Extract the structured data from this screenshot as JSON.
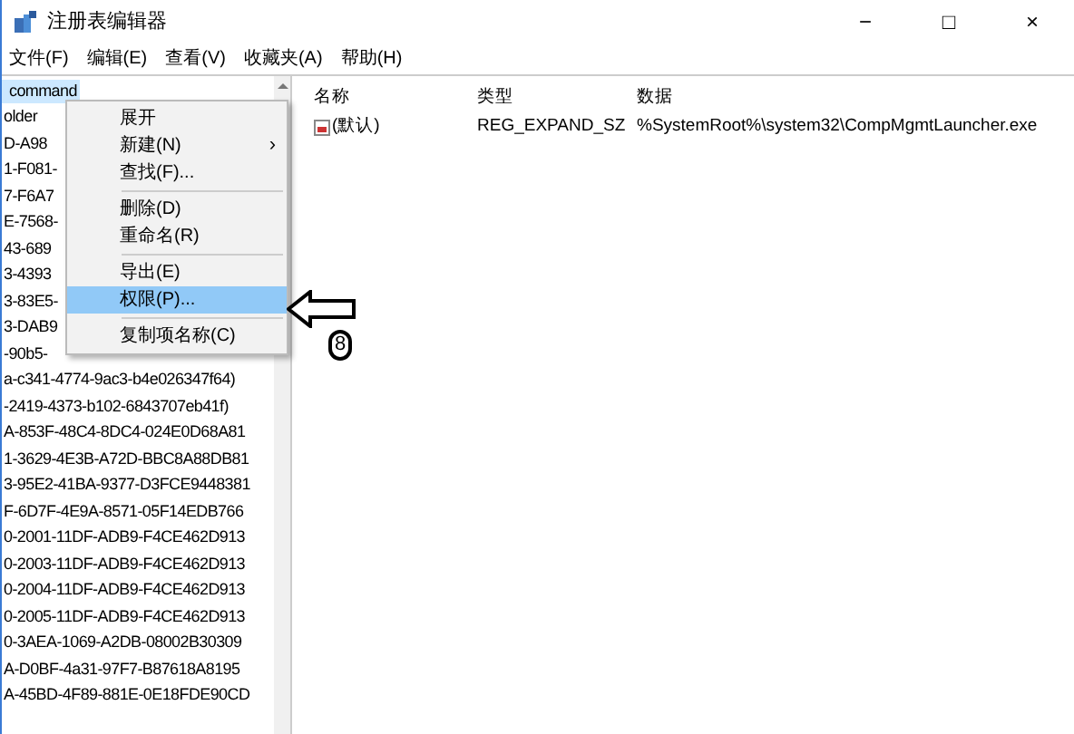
{
  "window": {
    "title": "注册表编辑器",
    "controls": [
      "−",
      "□",
      "×"
    ]
  },
  "menu_bar": [
    "文件(F)",
    "编辑(E)",
    "查看(V)",
    "收藏夹(A)",
    "帮助(H)"
  ],
  "tree": {
    "items": [
      {
        "label": "command",
        "selected": true
      },
      {
        "label": "older",
        "selected": false
      },
      {
        "label": "D-A98",
        "selected": false
      },
      {
        "label": "1-F081-",
        "selected": false
      },
      {
        "label": "7-F6A7",
        "selected": false
      },
      {
        "label": "E-7568-",
        "selected": false
      },
      {
        "label": "43-689",
        "selected": false
      },
      {
        "label": "3-4393",
        "selected": false
      },
      {
        "label": "3-83E5-",
        "selected": false
      },
      {
        "label": "3-DAB9",
        "selected": false
      },
      {
        "label": "-90b5-",
        "selected": false
      },
      {
        "label": "a-c341-4774-9ac3-b4e026347f64)",
        "selected": false
      },
      {
        "label": "-2419-4373-b102-6843707eb41f)",
        "selected": false
      },
      {
        "label": "A-853F-48C4-8DC4-024E0D68A81",
        "selected": false
      },
      {
        "label": "1-3629-4E3B-A72D-BBC8A88DB81",
        "selected": false
      },
      {
        "label": "3-95E2-41BA-9377-D3FCE9448381",
        "selected": false
      },
      {
        "label": "F-6D7F-4E9A-8571-05F14EDB766",
        "selected": false
      },
      {
        "label": "0-2001-11DF-ADB9-F4CE462D913",
        "selected": false
      },
      {
        "label": "0-2003-11DF-ADB9-F4CE462D913",
        "selected": false
      },
      {
        "label": "0-2004-11DF-ADB9-F4CE462D913",
        "selected": false
      },
      {
        "label": "0-2005-11DF-ADB9-F4CE462D913",
        "selected": false
      },
      {
        "label": "0-3AEA-1069-A2DB-08002B30309",
        "selected": false
      },
      {
        "label": "A-D0BF-4a31-97F7-B87618A8195",
        "selected": false
      },
      {
        "label": "A-45BD-4F89-881E-0E18FDE90CD",
        "selected": false
      }
    ]
  },
  "values": {
    "columns": [
      "名称",
      "类型",
      "数据"
    ],
    "rows": [
      {
        "name": "(默认)",
        "type": "REG_EXPAND_SZ",
        "data": "%SystemRoot%\\system32\\CompMgmtLauncher.exe"
      }
    ]
  },
  "context_menu": [
    {
      "kind": "item",
      "label": "展开",
      "selected": false
    },
    {
      "kind": "submenu",
      "label": "新建(N)",
      "arrow": "›",
      "selected": false
    },
    {
      "kind": "item",
      "label": "查找(F)...",
      "selected": false
    },
    {
      "kind": "separator"
    },
    {
      "kind": "item",
      "label": "删除(D)",
      "selected": false
    },
    {
      "kind": "item",
      "label": "重命名(R)",
      "selected": false
    },
    {
      "kind": "separator"
    },
    {
      "kind": "item",
      "label": "导出(E)",
      "selected": false
    },
    {
      "kind": "item",
      "label": "权限(P)...",
      "selected": true
    },
    {
      "kind": "separator"
    },
    {
      "kind": "item",
      "label": "复制项名称(C)",
      "selected": false
    }
  ],
  "annotation": {
    "step": "8"
  }
}
